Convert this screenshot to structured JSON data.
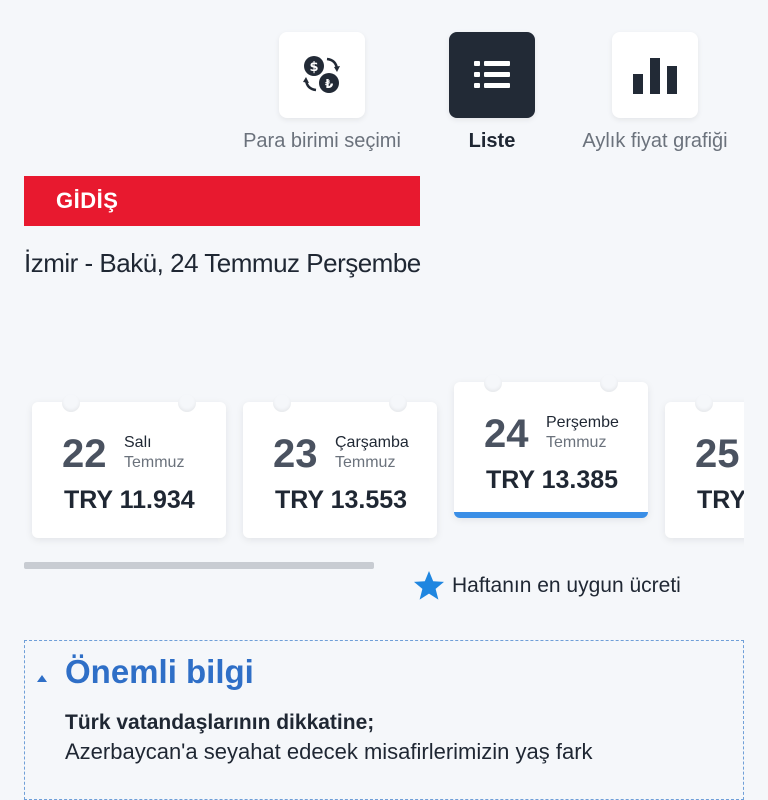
{
  "toolbar": {
    "items": [
      {
        "label": "Para birimi seçimi",
        "icon": "currency-exchange-icon",
        "active": false
      },
      {
        "label": "Liste",
        "icon": "list-icon",
        "active": true
      },
      {
        "label": "Aylık fiyat grafiği",
        "icon": "bar-chart-icon",
        "active": false
      }
    ]
  },
  "departure": {
    "label": "GİDİŞ",
    "route": "İzmir - Bakü, 24 Temmuz Perşembe"
  },
  "dates": [
    {
      "day": "22",
      "day_name": "Salı",
      "month": "Temmuz",
      "price": "TRY 11.934",
      "selected": false
    },
    {
      "day": "23",
      "day_name": "Çarşamba",
      "month": "Temmuz",
      "price": "TRY 13.553",
      "selected": false
    },
    {
      "day": "24",
      "day_name": "Perşembe",
      "month": "Temmuz",
      "price": "TRY 13.385",
      "selected": true
    },
    {
      "day": "25",
      "day_name": "",
      "month": "",
      "price": "TRY",
      "selected": false
    }
  ],
  "best_price_note": "Haftanın en uygun ücreti",
  "info": {
    "title": "Önemli bilgi",
    "heading": "Türk vatandaşlarının dikkatine;",
    "body": "Azerbaycan'a seyahat edecek misafirlerimizin yaş fark"
  },
  "colors": {
    "brand_red": "#e8192f",
    "accent_blue": "#2f6fc7",
    "selected_underline": "#3a8ee6",
    "star": "#1f86e0",
    "active_tile": "#222a36"
  }
}
